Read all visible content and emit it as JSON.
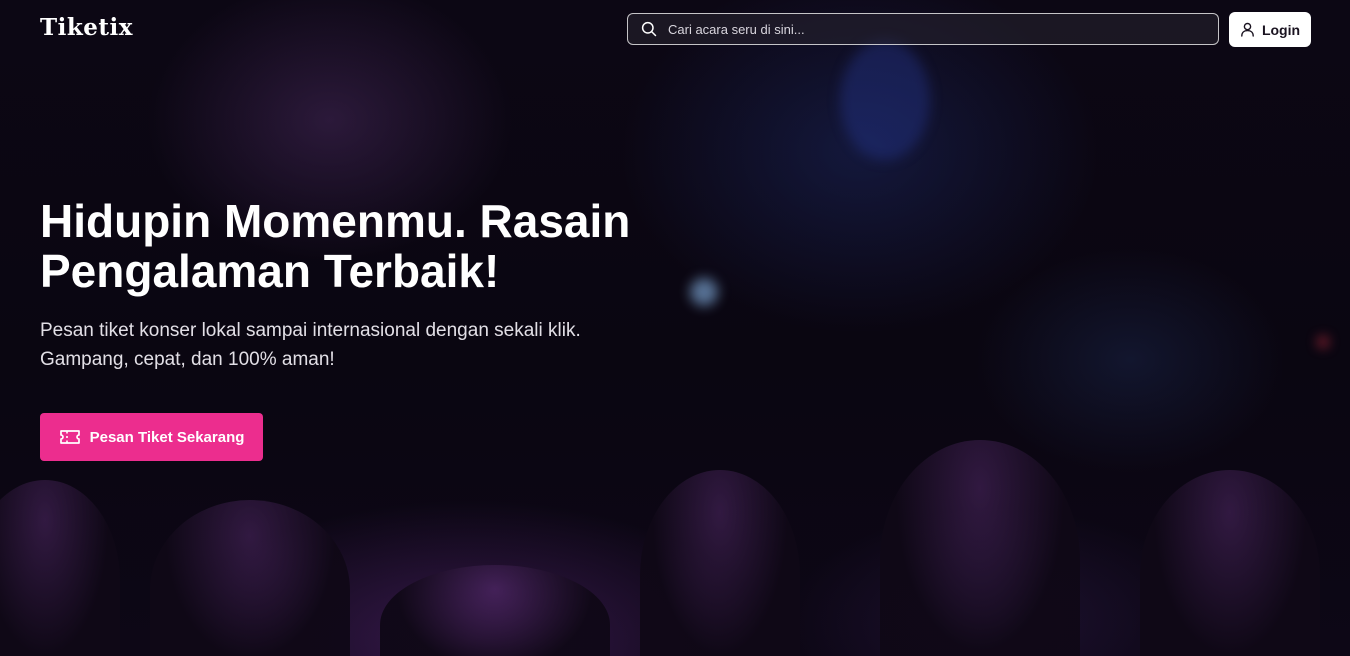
{
  "header": {
    "logo_text": "Tiketix",
    "search": {
      "placeholder": "Cari acara seru di sini...",
      "value": "",
      "icon": "search-icon"
    },
    "login": {
      "label": "Login",
      "icon": "user-icon"
    }
  },
  "hero": {
    "headline_line1": "Hidupin Momenmu. Rasain",
    "headline_line2": "Pengalaman Terbaik!",
    "subtitle_line1": "Pesan tiket konser lokal sampai internasional dengan sekali klik.",
    "subtitle_line2": "Gampang, cepat, dan 100% aman!",
    "cta": {
      "label": "Pesan Tiket Sekarang",
      "icon": "ticket-icon"
    }
  },
  "colors": {
    "accent": "#ec2d8e",
    "background": "#0b0612",
    "login_bg": "#ffffff"
  }
}
